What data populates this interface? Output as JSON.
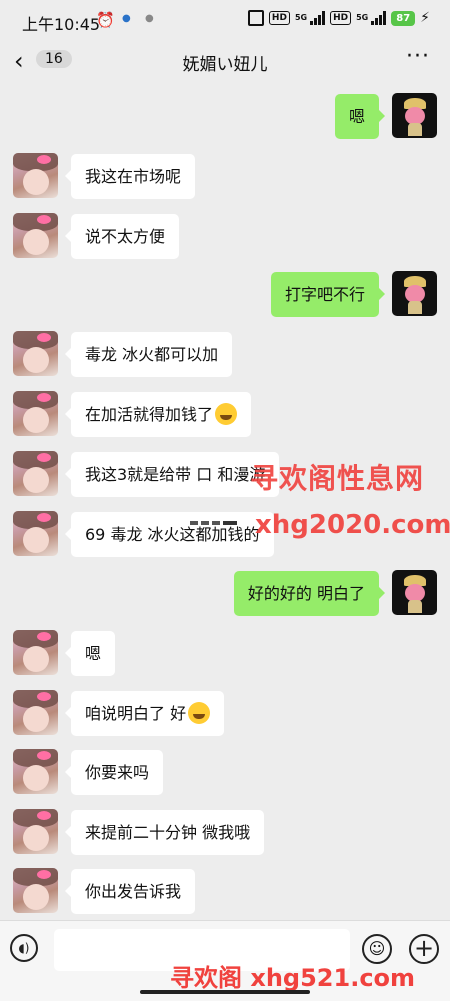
{
  "status_bar": {
    "time": "上午10:45",
    "network1": "5G",
    "network2": "5G",
    "hd_label": "HD",
    "battery": "87"
  },
  "header": {
    "unread_count": "16",
    "title": "妩媚い妞儿"
  },
  "messages": [
    {
      "side": "right",
      "text": "嗯"
    },
    {
      "side": "left",
      "text": "我这在市场呢"
    },
    {
      "side": "left",
      "text": "说不太方便"
    },
    {
      "side": "right",
      "text": "打字吧不行"
    },
    {
      "side": "left",
      "text": "毒龙 冰火都可以加"
    },
    {
      "side": "left",
      "text": "在加活就得加钱了",
      "emoji": "rolling-on-floor-laughing"
    },
    {
      "side": "left",
      "text": "我这3就是给带 口 和漫游"
    },
    {
      "side": "left",
      "text": "69  毒龙 冰火这都加钱的"
    },
    {
      "side": "right",
      "text": "好的好的 明白了"
    },
    {
      "side": "left",
      "text": "嗯"
    },
    {
      "side": "left",
      "text": "咱说明白了 好",
      "emoji": "grinning-face"
    },
    {
      "side": "left",
      "text": "你要来吗"
    },
    {
      "side": "left",
      "text": "来提前二十分钟 微我哦"
    },
    {
      "side": "left",
      "text": "你出发告诉我"
    }
  ],
  "watermarks": {
    "top_cn": "寻欢阁性息网",
    "top_url": "xhg2020.com",
    "bottom": "寻欢阁 xhg521.com"
  },
  "input_bar": {
    "voice_icon": "voice-icon",
    "emoji_icon": "smiley-icon",
    "plus_icon": "plus-icon"
  },
  "colors": {
    "background": "#ededed",
    "bubble_self": "#95ec69",
    "bubble_other": "#ffffff",
    "watermark": "#f0423e"
  }
}
